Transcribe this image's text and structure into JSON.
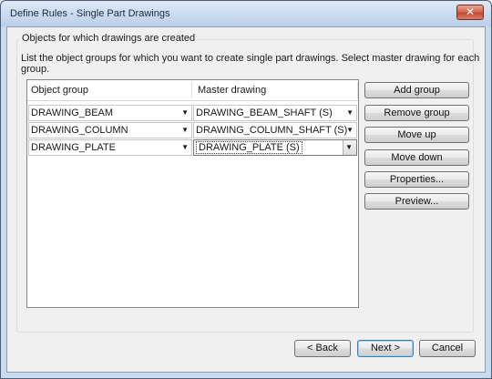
{
  "window": {
    "title": "Define Rules - Single Part Drawings",
    "close_glyph": "✕"
  },
  "group": {
    "legend": "Objects for which drawings are created",
    "description": "List the object groups for which you want to create single part drawings. Select master drawing for each group."
  },
  "table": {
    "columns": [
      "Object group",
      "Master drawing"
    ],
    "rows": [
      {
        "object_group": "DRAWING_BEAM",
        "master_drawing": "DRAWING_BEAM_SHAFT (S)"
      },
      {
        "object_group": "DRAWING_COLUMN",
        "master_drawing": "DRAWING_COLUMN_SHAFT (S)"
      },
      {
        "object_group": "DRAWING_PLATE",
        "master_drawing": "DRAWING_PLATE (S)"
      }
    ],
    "dropdown_glyph": "▼"
  },
  "side_buttons": {
    "add_group": "Add group",
    "remove_group": "Remove group",
    "move_up": "Move up",
    "move_down": "Move down",
    "properties": "Properties...",
    "preview": "Preview..."
  },
  "footer": {
    "back": "< Back",
    "next": "Next >",
    "cancel": "Cancel"
  }
}
